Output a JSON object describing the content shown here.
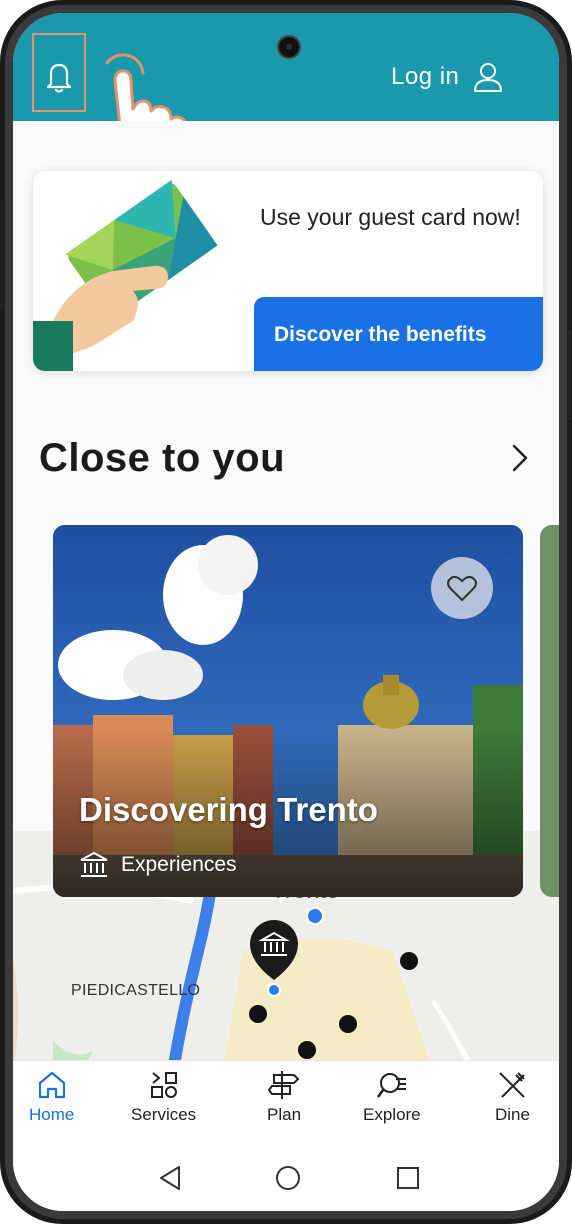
{
  "header": {
    "login_label": "Log in"
  },
  "banner": {
    "text": "Use your guest card now!",
    "button_label": "Discover the benefits"
  },
  "section": {
    "title": "Close to you"
  },
  "card": {
    "title": "Discovering Trento",
    "category": "Experiences"
  },
  "map": {
    "label_district": "PIEDICASTELLO",
    "label_city": "Trento"
  },
  "tabs": [
    {
      "label": "Home",
      "icon": "home-icon",
      "active": true
    },
    {
      "label": "Services",
      "icon": "services-icon",
      "active": false
    },
    {
      "label": "Plan",
      "icon": "signpost-icon",
      "active": false
    },
    {
      "label": "Explore",
      "icon": "explore-icon",
      "active": false
    },
    {
      "label": "Dine",
      "icon": "fork-knife-icon",
      "active": false
    }
  ],
  "colors": {
    "header": "#1a98ac",
    "accent": "#1a71e6",
    "highlight": "#e2936d"
  }
}
